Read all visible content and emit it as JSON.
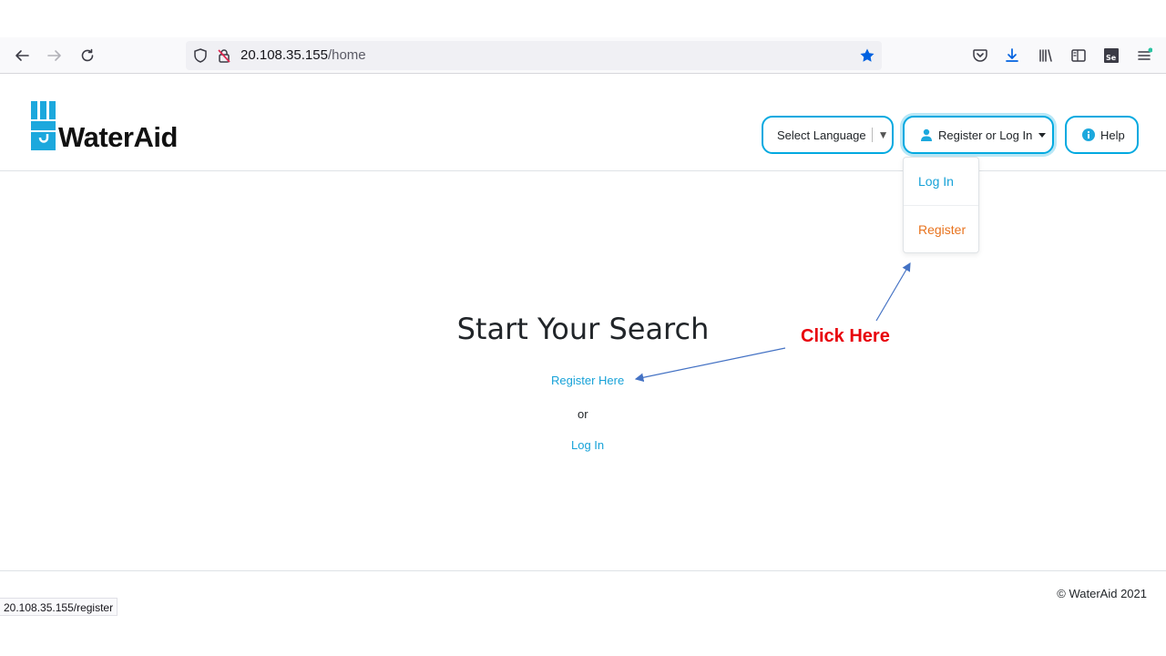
{
  "browser": {
    "url_host": "20.108.35.155",
    "url_path": "/home",
    "status_url": "20.108.35.155/register",
    "icons": [
      "back-icon",
      "forward-icon",
      "reload-icon",
      "shield-icon",
      "insecure-lock-icon",
      "bookmark-star-icon",
      "pocket-icon",
      "download-icon",
      "library-icon",
      "sidebar-icon",
      "selenium-icon",
      "menu-icon"
    ]
  },
  "header": {
    "logo_text": "WaterAid",
    "language_label": "Select Language",
    "auth_label": "Register or Log In",
    "help_label": "Help"
  },
  "dropdown": {
    "login": "Log In",
    "register": "Register"
  },
  "main": {
    "title": "Start Your Search",
    "register_link": "Register Here",
    "or_text": "or",
    "login_link": "Log In"
  },
  "annotation": {
    "callout": "Click Here"
  },
  "footer": {
    "copyright": "© WaterAid 2021"
  },
  "colors": {
    "accent": "#00a9e0",
    "link": "#17a2d8",
    "register": "#e8731e",
    "callout": "#e8000b"
  }
}
